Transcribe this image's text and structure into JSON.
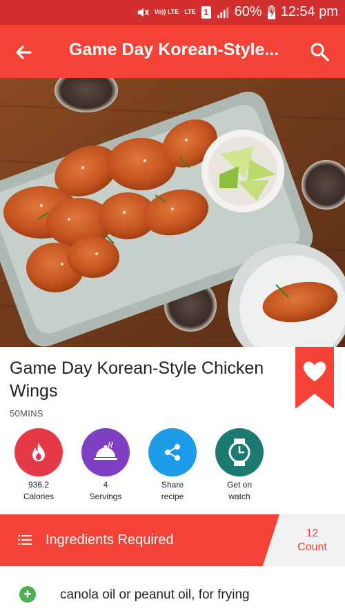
{
  "status_bar": {
    "volte": "Vo)) LTE",
    "lte": "LTE",
    "sim": "1",
    "battery": "60%",
    "time": "12:54 pm"
  },
  "app_bar": {
    "title": "Game Day Korean-Style...",
    "back_icon": "arrow-back-icon",
    "search_icon": "search-icon"
  },
  "recipe": {
    "title": "Game Day Korean-Style Chicken Wings",
    "duration": "50MINS",
    "favorite_icon": "heart-icon"
  },
  "actions": [
    {
      "value": "936.2",
      "label": "Calories",
      "icon": "flame-icon",
      "color": "#e53945"
    },
    {
      "value": "4",
      "label": "Servings",
      "icon": "cloche-icon",
      "color": "#7e3fc4"
    },
    {
      "value": "Share",
      "label": "recipe",
      "icon": "share-icon",
      "color": "#1e9be8"
    },
    {
      "value": "Get on",
      "label": "watch",
      "icon": "watch-icon",
      "color": "#1d7a72"
    }
  ],
  "ingredients": {
    "title": "Ingredients Required",
    "count_value": "12",
    "count_label": "Count",
    "items": [
      {
        "text": "canola oil or peanut oil, for frying"
      }
    ]
  },
  "colors": {
    "status": "#d32f2f",
    "accent": "#f44336",
    "add": "#4caf50"
  }
}
